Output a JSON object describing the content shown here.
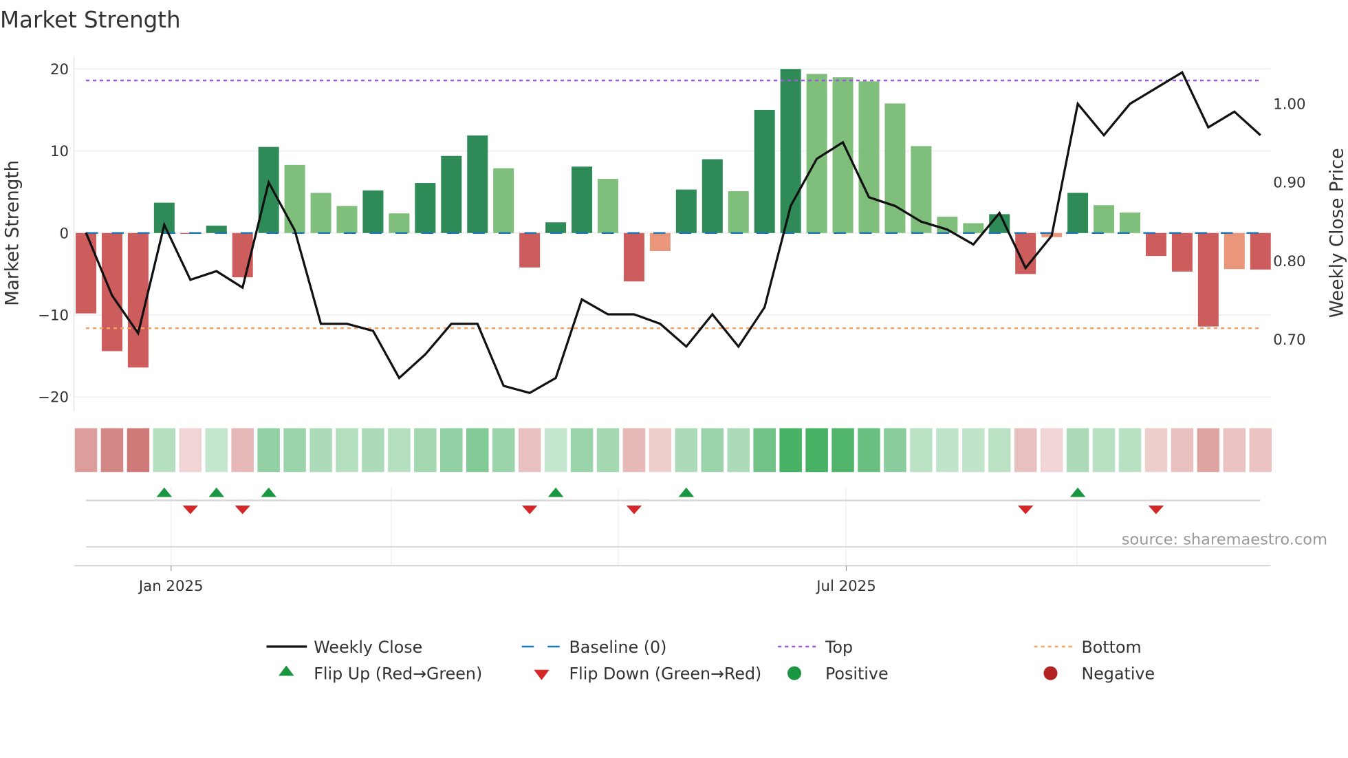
{
  "chart_data": {
    "type": "bar",
    "title": "Market Strength",
    "ylabel": "Market Strength",
    "y2label": "Weekly Close Price",
    "ylim": [
      -21.7,
      21.6
    ],
    "y2lim": [
      0.609,
      1.061
    ],
    "yticks": [
      20,
      10,
      0,
      -10,
      -20
    ],
    "ytick_labels": [
      "20",
      "10",
      "0",
      "−10",
      "−20"
    ],
    "y2ticks": [
      1.0,
      0.9,
      0.8,
      0.7
    ],
    "y2tick_labels": [
      "1.00",
      "0.90",
      "0.80",
      "0.70"
    ],
    "xticks": [
      {
        "label": "Jan 2025",
        "week": 3.26
      },
      {
        "label": "Jul 2025",
        "week": 29.13
      }
    ],
    "grid": true,
    "baseline": 0,
    "top": 18.6,
    "bottom": -11.6,
    "strength": [
      -9.8,
      -14.4,
      -16.4,
      3.7,
      -0.1,
      0.9,
      -5.4,
      10.5,
      8.3,
      4.9,
      3.3,
      5.2,
      2.4,
      6.1,
      9.4,
      11.9,
      7.9,
      -4.2,
      1.3,
      8.1,
      6.6,
      -5.9,
      -2.2,
      5.3,
      9.0,
      5.1,
      15.0,
      20.0,
      19.4,
      19.0,
      18.5,
      15.8,
      10.6,
      2.0,
      1.2,
      2.3,
      -5.0,
      -0.5,
      4.9,
      3.4,
      2.5,
      -2.8,
      -4.7,
      -11.4,
      -4.4,
      -4.45
    ],
    "weekly_close": [
      0.836,
      0.756,
      0.708,
      0.846,
      0.776,
      0.787,
      0.766,
      0.9,
      0.839,
      0.72,
      0.72,
      0.711,
      0.651,
      0.681,
      0.72,
      0.72,
      0.641,
      0.632,
      0.651,
      0.751,
      0.732,
      0.732,
      0.72,
      0.691,
      0.732,
      0.691,
      0.741,
      0.87,
      0.93,
      0.951,
      0.881,
      0.87,
      0.85,
      0.84,
      0.821,
      0.861,
      0.791,
      0.832,
      1.0,
      0.96,
      1.0,
      1.02,
      1.04,
      0.97,
      0.99,
      0.96
    ],
    "heat": [
      -0.55,
      -0.7,
      -0.8,
      0.3,
      -0.15,
      0.2,
      -0.35,
      0.5,
      0.45,
      0.35,
      0.3,
      0.35,
      0.3,
      0.4,
      0.5,
      0.6,
      0.45,
      -0.3,
      0.2,
      0.45,
      0.4,
      -0.35,
      -0.2,
      0.35,
      0.45,
      0.35,
      0.7,
      0.95,
      0.95,
      0.9,
      0.75,
      0.55,
      0.25,
      0.22,
      0.22,
      0.25,
      -0.3,
      -0.15,
      0.35,
      0.28,
      0.28,
      -0.2,
      -0.3,
      -0.5,
      -0.28,
      -0.28
    ],
    "flip_up_weeks": [
      3,
      5,
      7,
      18,
      23,
      38
    ],
    "flip_down_weeks": [
      4,
      6,
      17,
      21,
      36,
      41
    ],
    "legend": {
      "placement": "bottom",
      "items": [
        {
          "label": "Weekly Close",
          "kind": "line",
          "color": "#111111"
        },
        {
          "label": "Baseline (0)",
          "kind": "dash",
          "color": "#1f77b4"
        },
        {
          "label": "Top",
          "kind": "dot",
          "color": "#9b59d6"
        },
        {
          "label": "Bottom",
          "kind": "dot",
          "color": "#f4a261"
        },
        {
          "label": "Flip Up (Red→Green)",
          "kind": "tri-up",
          "color": "#1a9641"
        },
        {
          "label": "Flip Down (Green→Red)",
          "kind": "tri-down",
          "color": "#d62728"
        },
        {
          "label": "Positive",
          "kind": "circle",
          "color": "#1a9641"
        },
        {
          "label": "Negative",
          "kind": "circle",
          "color": "#b22222"
        }
      ]
    },
    "colors": {
      "up_strong": "#2e8b57",
      "up_weak": "#7fbf7b",
      "down_strong": "#cd5c5c",
      "down_weak": "#e9967a",
      "heat_pos": "#2ea64e",
      "heat_neg": "#c0504d"
    },
    "source": "source: sharemaestro.com"
  }
}
